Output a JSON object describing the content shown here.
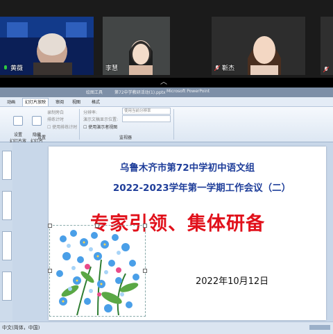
{
  "video_call": {
    "participants": [
      {
        "name": "黄薇",
        "mic": "mic-on"
      },
      {
        "name": "李慧",
        "mic": "none"
      },
      {
        "name": "靳杰",
        "mic": "mic-muted"
      },
      {
        "name": "",
        "mic": "mic-muted"
      }
    ]
  },
  "ppt": {
    "title_segments": [
      "绘图工具",
      "第72中学教研活动(1).pptx",
      "Microsoft PowerPoint"
    ],
    "tabs": [
      "动画",
      "幻灯片放映",
      "审阅",
      "视图",
      "格式"
    ],
    "active_tab_index": 1,
    "ribbon": {
      "setup_group_label": "设置",
      "monitor_group_label": "监视器",
      "setup_slideshow_label": "设置\n幻灯片放映",
      "hide_slide_label": "隐藏\n幻灯片",
      "rehearse_label": "录制旁白",
      "rehearse_timings_label": "排练计时",
      "use_timings_label": "使用排练计时",
      "resolution_label": "分辨率:",
      "resolution_value": "使用当前分辨率",
      "show_on_label": "演示文稿显示位置:",
      "presenter_view_label": "使用演示者视图"
    },
    "slide": {
      "line1": "乌鲁木齐市第72中学初中语文组",
      "line2": "2022-2023学年第一学期工作会议（二）",
      "headline": "专家引领、集体研备",
      "date": "2022年10月12日",
      "colors": {
        "title_blue": "#1f3e9a",
        "headline_red": "#e1111b"
      }
    },
    "status_bar": "中文(简体，中国)"
  }
}
